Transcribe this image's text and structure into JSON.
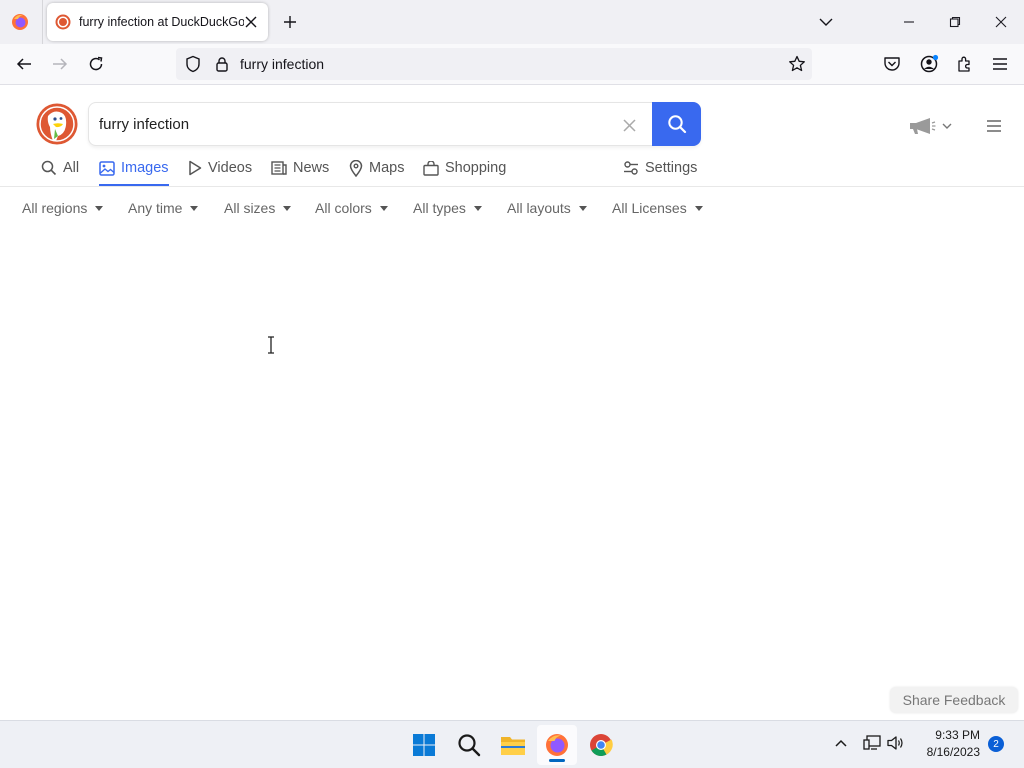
{
  "browser": {
    "tab_title": "furry infection at DuckDuckGo",
    "url": "furry infection"
  },
  "search": {
    "query": "furry infection"
  },
  "nav_tabs": [
    {
      "label": "All",
      "icon": "search-icon"
    },
    {
      "label": "Images",
      "icon": "image-icon",
      "active": true
    },
    {
      "label": "Videos",
      "icon": "play-icon"
    },
    {
      "label": "News",
      "icon": "newspaper-icon"
    },
    {
      "label": "Maps",
      "icon": "map-pin-icon"
    },
    {
      "label": "Shopping",
      "icon": "shopping-bag-icon"
    }
  ],
  "settings_label": "Settings",
  "filters": [
    "All regions",
    "Any time",
    "All sizes",
    "All colors",
    "All types",
    "All layouts",
    "All Licenses"
  ],
  "feedback_label": "Share Feedback",
  "taskbar": {
    "time": "9:33 PM",
    "date": "8/16/2023",
    "notifications": "2"
  },
  "colors": {
    "accent": "#3969ef",
    "ddg_orange": "#de5833"
  }
}
